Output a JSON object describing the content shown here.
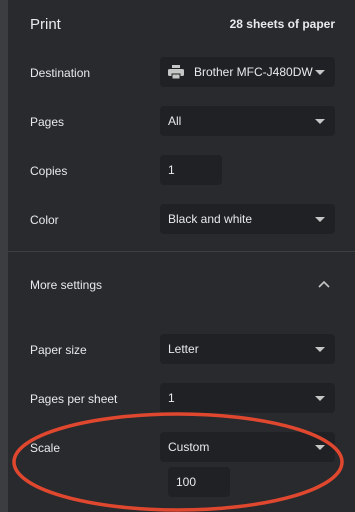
{
  "header": {
    "title": "Print",
    "sheets": "28 sheets of paper"
  },
  "destination": {
    "label": "Destination",
    "value": "Brother MFC-J480DW",
    "icon": "printer-icon"
  },
  "pages": {
    "label": "Pages",
    "value": "All"
  },
  "copies": {
    "label": "Copies",
    "value": "1"
  },
  "color": {
    "label": "Color",
    "value": "Black and white"
  },
  "more_settings": {
    "label": "More settings",
    "icon": "chevron-up-icon"
  },
  "paper_size": {
    "label": "Paper size",
    "value": "Letter"
  },
  "pages_per_sheet": {
    "label": "Pages per sheet",
    "value": "1"
  },
  "scale": {
    "label": "Scale",
    "value": "Custom",
    "custom_value": "100"
  },
  "colors": {
    "background": "#292a2d",
    "field": "#202124",
    "annotation": "#e0472f"
  }
}
